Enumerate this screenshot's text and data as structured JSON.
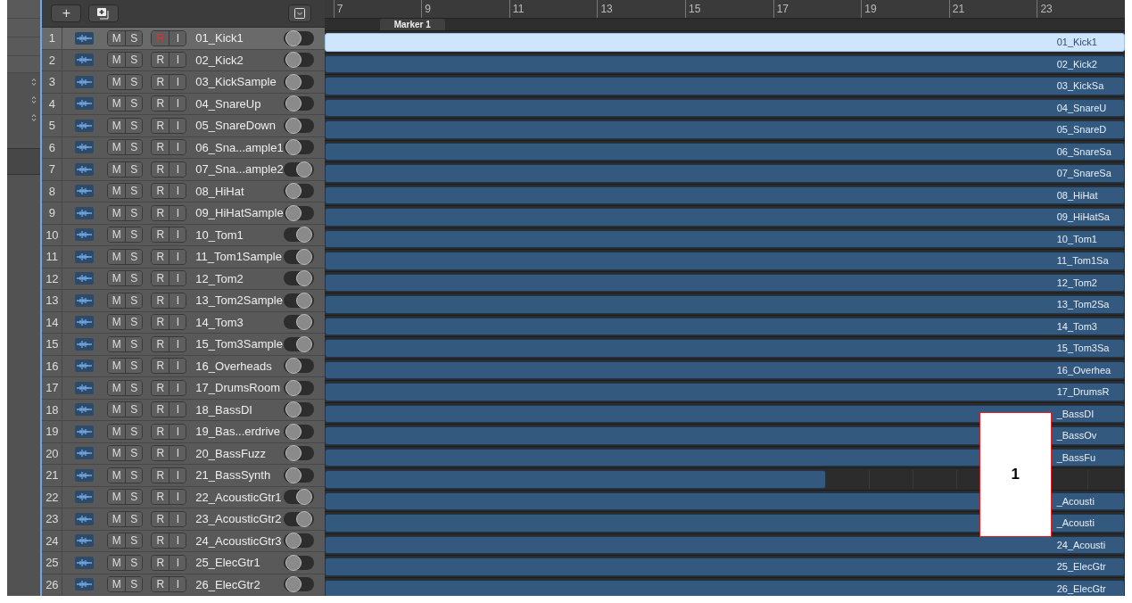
{
  "toolbar": {
    "add_button": "+"
  },
  "ruler": {
    "bars": [
      "7",
      "9",
      "11",
      "13",
      "15",
      "17",
      "19",
      "21",
      "23"
    ],
    "marker": "Marker 1"
  },
  "tracks": [
    {
      "number": "1",
      "name": "01_Kick1",
      "mute": "M",
      "solo": "S",
      "record": "R",
      "input": "I",
      "selected": true,
      "record_armed": true,
      "on": false,
      "region": {
        "kind": "full",
        "name": "01_Kick1"
      }
    },
    {
      "number": "2",
      "name": "02_Kick2",
      "mute": "M",
      "solo": "S",
      "record": "R",
      "input": "I",
      "selected": false,
      "record_armed": false,
      "on": false,
      "region": {
        "kind": "full",
        "name": "02_Kick2"
      }
    },
    {
      "number": "3",
      "name": "03_KickSample",
      "mute": "M",
      "solo": "S",
      "record": "R",
      "input": "I",
      "selected": false,
      "record_armed": false,
      "on": false,
      "region": {
        "kind": "full",
        "name": "03_KickSa"
      }
    },
    {
      "number": "4",
      "name": "04_SnareUp",
      "mute": "M",
      "solo": "S",
      "record": "R",
      "input": "I",
      "selected": false,
      "record_armed": false,
      "on": false,
      "region": {
        "kind": "full",
        "name": "04_SnareU"
      }
    },
    {
      "number": "5",
      "name": "05_SnareDown",
      "mute": "M",
      "solo": "S",
      "record": "R",
      "input": "I",
      "selected": false,
      "record_armed": false,
      "on": false,
      "region": {
        "kind": "full",
        "name": "05_SnareD"
      }
    },
    {
      "number": "6",
      "name": "06_Sna...ample1",
      "mute": "M",
      "solo": "S",
      "record": "R",
      "input": "I",
      "selected": false,
      "record_armed": false,
      "on": false,
      "region": {
        "kind": "full",
        "name": "06_SnareSa"
      }
    },
    {
      "number": "7",
      "name": "07_Sna...ample2",
      "mute": "M",
      "solo": "S",
      "record": "R",
      "input": "I",
      "selected": false,
      "record_armed": false,
      "on": true,
      "region": {
        "kind": "full",
        "name": "07_SnareSa"
      }
    },
    {
      "number": "8",
      "name": "08_HiHat",
      "mute": "M",
      "solo": "S",
      "record": "R",
      "input": "I",
      "selected": false,
      "record_armed": false,
      "on": false,
      "region": {
        "kind": "full",
        "name": "08_HiHat"
      }
    },
    {
      "number": "9",
      "name": "09_HiHatSample",
      "mute": "M",
      "solo": "S",
      "record": "R",
      "input": "I",
      "selected": false,
      "record_armed": false,
      "on": false,
      "region": {
        "kind": "full",
        "name": "09_HiHatSa"
      }
    },
    {
      "number": "10",
      "name": "10_Tom1",
      "mute": "M",
      "solo": "S",
      "record": "R",
      "input": "I",
      "selected": false,
      "record_armed": false,
      "on": true,
      "region": {
        "kind": "full",
        "name": "10_Tom1"
      }
    },
    {
      "number": "11",
      "name": "11_Tom1Sample",
      "mute": "M",
      "solo": "S",
      "record": "R",
      "input": "I",
      "selected": false,
      "record_armed": false,
      "on": true,
      "region": {
        "kind": "full",
        "name": "11_Tom1Sa"
      }
    },
    {
      "number": "12",
      "name": "12_Tom2",
      "mute": "M",
      "solo": "S",
      "record": "R",
      "input": "I",
      "selected": false,
      "record_armed": false,
      "on": true,
      "region": {
        "kind": "full",
        "name": "12_Tom2"
      }
    },
    {
      "number": "13",
      "name": "13_Tom2Sample",
      "mute": "M",
      "solo": "S",
      "record": "R",
      "input": "I",
      "selected": false,
      "record_armed": false,
      "on": true,
      "region": {
        "kind": "full",
        "name": "13_Tom2Sa"
      }
    },
    {
      "number": "14",
      "name": "14_Tom3",
      "mute": "M",
      "solo": "S",
      "record": "R",
      "input": "I",
      "selected": false,
      "record_armed": false,
      "on": true,
      "region": {
        "kind": "full",
        "name": "14_Tom3"
      }
    },
    {
      "number": "15",
      "name": "15_Tom3Sample",
      "mute": "M",
      "solo": "S",
      "record": "R",
      "input": "I",
      "selected": false,
      "record_armed": false,
      "on": true,
      "region": {
        "kind": "full",
        "name": "15_Tom3Sa"
      }
    },
    {
      "number": "16",
      "name": "16_Overheads",
      "mute": "M",
      "solo": "S",
      "record": "R",
      "input": "I",
      "selected": false,
      "record_armed": false,
      "on": false,
      "region": {
        "kind": "full",
        "name": "16_Overhea"
      }
    },
    {
      "number": "17",
      "name": "17_DrumsRoom",
      "mute": "M",
      "solo": "S",
      "record": "R",
      "input": "I",
      "selected": false,
      "record_armed": false,
      "on": false,
      "region": {
        "kind": "full",
        "name": "17_DrumsR"
      }
    },
    {
      "number": "18",
      "name": "18_BassDI",
      "mute": "M",
      "solo": "S",
      "record": "R",
      "input": "I",
      "selected": false,
      "record_armed": false,
      "on": false,
      "region": {
        "kind": "full",
        "name": "_BassDI"
      }
    },
    {
      "number": "19",
      "name": "19_Bas...erdrive",
      "mute": "M",
      "solo": "S",
      "record": "R",
      "input": "I",
      "selected": false,
      "record_armed": false,
      "on": false,
      "region": {
        "kind": "full",
        "name": "_BassOv"
      }
    },
    {
      "number": "20",
      "name": "20_BassFuzz",
      "mute": "M",
      "solo": "S",
      "record": "R",
      "input": "I",
      "selected": false,
      "record_armed": false,
      "on": false,
      "region": {
        "kind": "full",
        "name": "_BassFu"
      }
    },
    {
      "number": "21",
      "name": "21_BassSynth",
      "mute": "M",
      "solo": "S",
      "record": "R",
      "input": "I",
      "selected": false,
      "record_armed": false,
      "on": false,
      "region": {
        "kind": "short"
      }
    },
    {
      "number": "22",
      "name": "22_AcousticGtr1",
      "mute": "M",
      "solo": "S",
      "record": "R",
      "input": "I",
      "selected": false,
      "record_armed": false,
      "on": true,
      "region": {
        "kind": "full",
        "name": "_Acousti"
      }
    },
    {
      "number": "23",
      "name": "23_AcousticGtr2",
      "mute": "M",
      "solo": "S",
      "record": "R",
      "input": "I",
      "selected": false,
      "record_armed": false,
      "on": true,
      "region": {
        "kind": "full",
        "name": "_Acousti"
      }
    },
    {
      "number": "24",
      "name": "24_AcousticGtr3",
      "mute": "M",
      "solo": "S",
      "record": "R",
      "input": "I",
      "selected": false,
      "record_armed": false,
      "on": false,
      "region": {
        "kind": "full",
        "name": "24_Acousti"
      }
    },
    {
      "number": "25",
      "name": "25_ElecGtr1",
      "mute": "M",
      "solo": "S",
      "record": "R",
      "input": "I",
      "selected": false,
      "record_armed": false,
      "on": false,
      "region": {
        "kind": "full",
        "name": "25_ElecGtr"
      }
    },
    {
      "number": "26",
      "name": "26_ElecGtr2",
      "mute": "M",
      "solo": "S",
      "record": "R",
      "input": "I",
      "selected": false,
      "record_armed": false,
      "on": false,
      "region": {
        "kind": "full",
        "name": "26_ElecGtr"
      }
    }
  ],
  "callout": {
    "label": "1"
  }
}
